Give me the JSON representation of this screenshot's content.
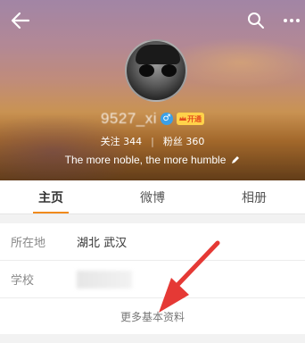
{
  "header": {
    "back_icon": "arrow-left-icon",
    "search_icon": "search-icon",
    "more_icon": "more-dots-icon"
  },
  "profile": {
    "username": "9527_xi",
    "gender_symbol": "♂",
    "vip_badge_text": "开通",
    "stats": {
      "following_label": "关注",
      "following_count": "344",
      "separator": "|",
      "followers_label": "粉丝",
      "followers_count": "360"
    },
    "bio": "The more noble, the more humble",
    "edit_icon": "pencil-icon"
  },
  "tabs": [
    {
      "label": "主页",
      "active": true
    },
    {
      "label": "微博",
      "active": false
    },
    {
      "label": "相册",
      "active": false
    }
  ],
  "info": {
    "location_label": "所在地",
    "location_value": "湖北 武汉",
    "school_label": "学校",
    "more_info_label": "更多基本资料"
  },
  "colors": {
    "accent": "#f08a1c",
    "annotation_arrow": "#e53935"
  }
}
